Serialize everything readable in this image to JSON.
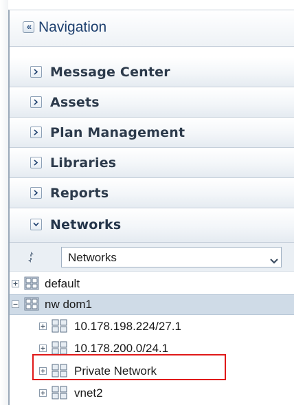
{
  "navigation": {
    "title": "Navigation",
    "collapse_glyph": "«"
  },
  "accordion": [
    {
      "label": "Message Center",
      "expanded": false
    },
    {
      "label": "Assets",
      "expanded": false
    },
    {
      "label": "Plan Management",
      "expanded": false
    },
    {
      "label": "Libraries",
      "expanded": false
    },
    {
      "label": "Reports",
      "expanded": false
    },
    {
      "label": "Networks",
      "expanded": true
    }
  ],
  "networks_panel": {
    "selector_value": "Networks",
    "tree": [
      {
        "label": "default",
        "expanded": false,
        "selected": false
      },
      {
        "label": "nw dom1",
        "expanded": true,
        "selected": true
      },
      {
        "label": "10.178.198.224/27.1",
        "expanded": false,
        "selected": false
      },
      {
        "label": "10.178.200.0/24.1",
        "expanded": false,
        "selected": false
      },
      {
        "label": "Private Network",
        "expanded": false,
        "selected": false,
        "highlighted": true
      },
      {
        "label": "vnet2",
        "expanded": false,
        "selected": false
      }
    ]
  },
  "colors": {
    "accent": "#1d3f6e",
    "highlight_border": "#e01818",
    "selected_row": "#cfdbe7"
  }
}
